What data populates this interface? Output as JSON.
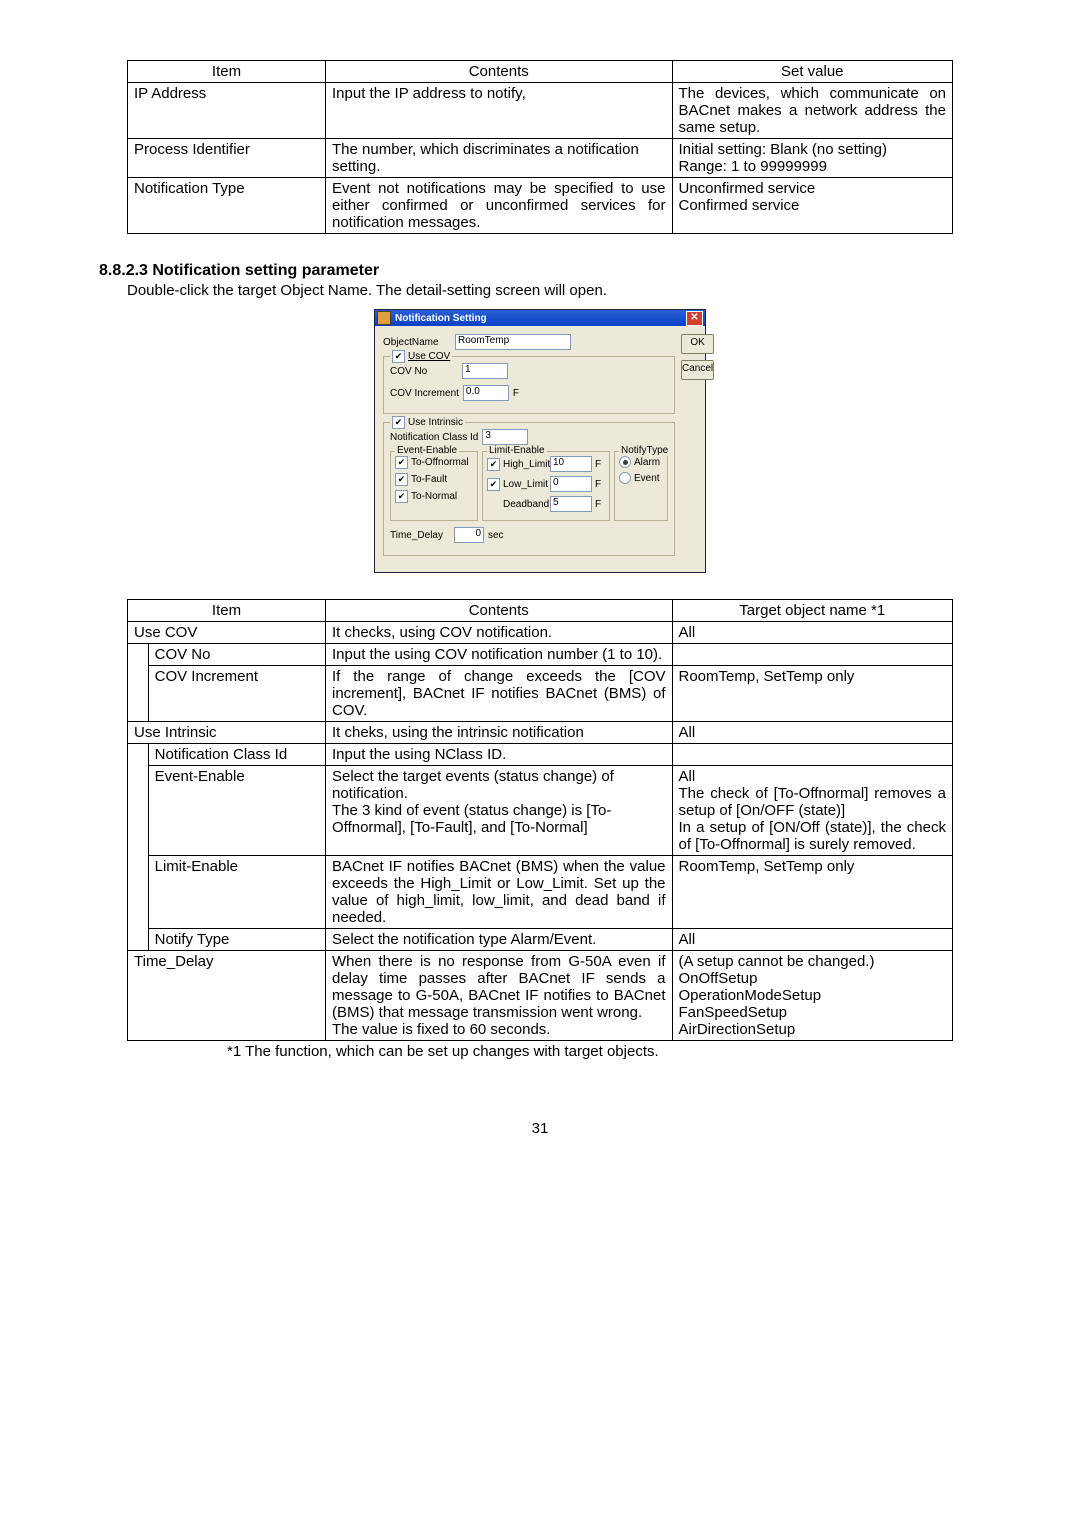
{
  "table1": {
    "headers": [
      "Item",
      "Contents",
      "Set value"
    ],
    "rows": [
      {
        "item": "IP Address",
        "contents": "Input the IP address to notify,",
        "set": "The devices, which communicate on BACnet makes a network address the same setup."
      },
      {
        "item": "Process Identifier",
        "contents": "The number, which discriminates a notification setting.",
        "set": "Initial setting: Blank (no setting)\nRange: 1 to 99999999"
      },
      {
        "item": "Notification Type",
        "contents": "Event not notifications may be specified to use either confirmed or unconfirmed services for notification messages.",
        "set": "Unconfirmed service\nConfirmed service"
      }
    ]
  },
  "section": {
    "heading": "8.8.2.3 Notification setting parameter",
    "text": "Double-click the target Object Name. The detail-setting screen will open."
  },
  "dialog": {
    "title": "Notification Setting",
    "close_glyph": "✕",
    "ok": "OK",
    "cancel": "Cancel",
    "objectname_label": "ObjectName",
    "objectname_value": "RoomTemp",
    "use_cov": {
      "legend": "Use COV",
      "cov_no_label": "COV No",
      "cov_no_value": "1",
      "cov_inc_label": "COV Increment",
      "cov_inc_value": "0.0",
      "cov_inc_unit": "F"
    },
    "use_intrinsic": {
      "legend": "Use Intrinsic",
      "ncid_label": "Notification Class Id",
      "ncid_value": "3",
      "event_enable": {
        "legend": "Event-Enable",
        "to_offnormal": "To-Offnormal",
        "to_fault": "To-Fault",
        "to_normal": "To-Normal"
      },
      "limit_enable": {
        "legend": "Limit-Enable",
        "high_limit_label": "High_Limit",
        "high_limit_value": "10",
        "high_limit_unit": "F",
        "low_limit_label": "Low_Limit",
        "low_limit_value": "0",
        "low_limit_unit": "F",
        "deadband_label": "Deadband",
        "deadband_value": "5",
        "deadband_unit": "F"
      },
      "notify_type": {
        "legend": "NotifyType",
        "alarm": "Alarm",
        "event": "Event"
      },
      "time_delay_label": "Time_Delay",
      "time_delay_value": "0",
      "time_delay_unit": "sec"
    }
  },
  "table2": {
    "headers": [
      "Item",
      "Contents",
      "Target object name *1"
    ],
    "rows": [
      {
        "item": "Use COV",
        "indent": false,
        "contents": "It checks, using COV notification.",
        "target": "All"
      },
      {
        "item": "COV No",
        "indent": true,
        "contents": "Input the using COV notification number (1 to 10).",
        "target": ""
      },
      {
        "item": "COV Increment",
        "indent": true,
        "contents": "If the range of change exceeds the [COV increment], BACnet IF notifies BACnet (BMS) of COV.",
        "target": "RoomTemp, SetTemp only"
      },
      {
        "item": "Use Intrinsic",
        "indent": false,
        "contents": "It cheks, using the intrinsic notification",
        "target": "All"
      },
      {
        "item": "Notification Class Id",
        "indent": true,
        "contents": "Input the using NClass ID.",
        "target": ""
      },
      {
        "item": "Event-Enable",
        "indent": true,
        "contents": "Select the target events (status change) of notification.\nThe 3 kind of event (status change) is [To-Offnormal], [To-Fault], and [To-Normal]",
        "target": "All\nThe check of [To-Offnormal] removes a setup of [On/OFF (state)]\nIn a setup of [ON/Off (state)], the check of [To-Offnormal] is surely removed."
      },
      {
        "item": "Limit-Enable",
        "indent": true,
        "contents": "BACnet IF notifies BACnet (BMS) when the value exceeds the High_Limit or Low_Limit. Set up the value of high_limit, low_limit, and dead band if needed.",
        "target": "RoomTemp, SetTemp only"
      },
      {
        "item": "Notify Type",
        "indent": true,
        "contents": "Select the notification type Alarm/Event.",
        "target": "All"
      },
      {
        "item": "Time_Delay",
        "indent": false,
        "contents": "When there is no response from G-50A even if delay time passes after BACnet IF sends a message to G-50A, BACnet IF notifies to BACnet (BMS) that message transmission went wrong.\nThe value is fixed to 60 seconds.",
        "target": "(A setup cannot be changed.)\nOnOffSetup\nOperationModeSetup\nFanSpeedSetup\nAirDirectionSetup"
      }
    ]
  },
  "footnote": "*1 The function, which can be set up changes with target objects.",
  "page_number": "31"
}
